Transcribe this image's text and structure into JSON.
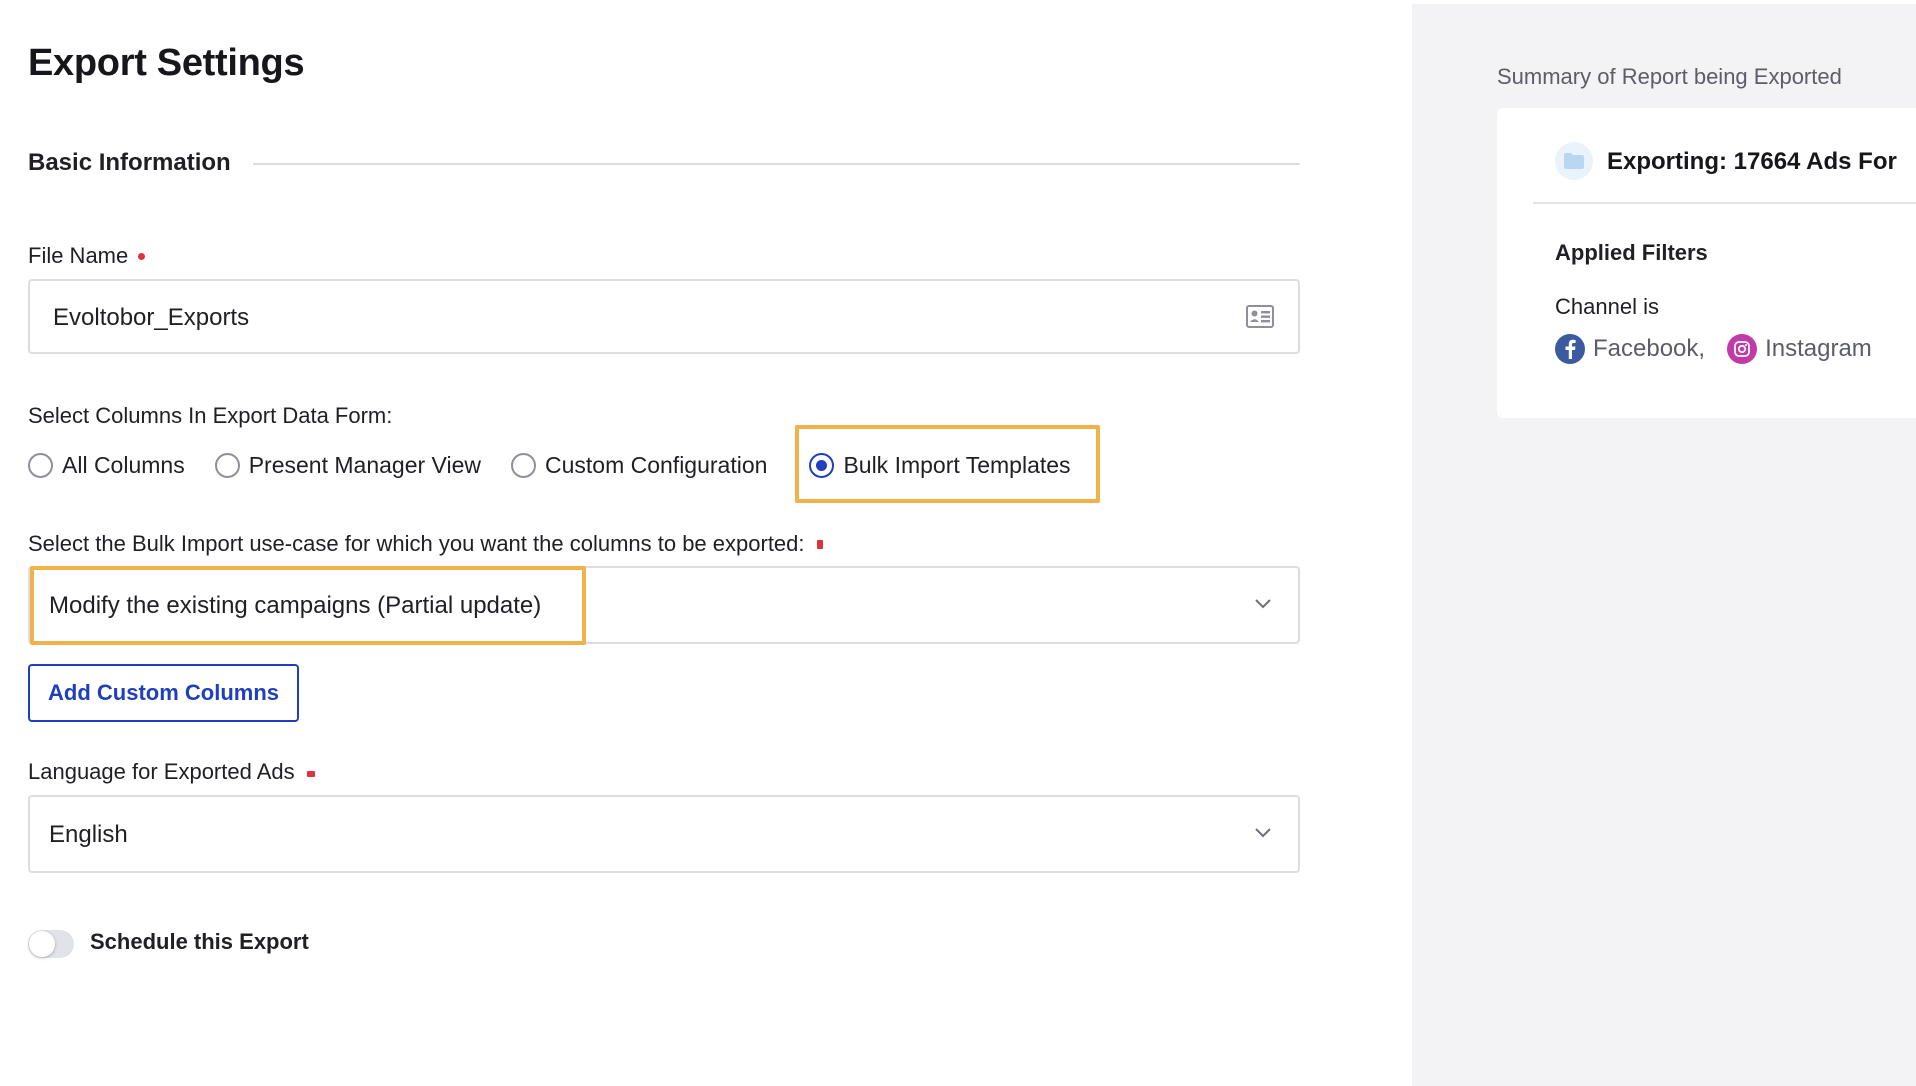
{
  "page": {
    "title": "Export Settings"
  },
  "basic_info": {
    "section_label": "Basic Information"
  },
  "file_name": {
    "label": "File Name",
    "value": "Evoltobor_Exports",
    "icon": "contact-card-icon"
  },
  "columns": {
    "label": "Select Columns In Export Data Form:",
    "options": [
      {
        "label": "All Columns",
        "checked": false
      },
      {
        "label": "Present Manager View",
        "checked": false
      },
      {
        "label": "Custom Configuration",
        "checked": false
      },
      {
        "label": "Bulk Import Templates",
        "checked": true
      }
    ]
  },
  "bulk_usecase": {
    "label": "Select the Bulk Import use-case for which you want the columns to be exported:",
    "value": "Modify the existing campaigns (Partial update)"
  },
  "add_columns_button": {
    "label": "Add Custom Columns"
  },
  "language": {
    "label": "Language for Exported Ads",
    "value": "English"
  },
  "schedule": {
    "label": "Schedule this Export",
    "enabled": false
  },
  "summary": {
    "title": "Summary of Report being Exported",
    "card_title": "Exporting: 17664 Ads For",
    "filters_label": "Applied Filters",
    "channel_label": "Channel is",
    "channels": [
      {
        "label": "Facebook,",
        "icon": "facebook-icon"
      },
      {
        "label": "Instagram",
        "icon": "instagram-icon"
      }
    ]
  },
  "colors": {
    "accent": "#1f3fbf",
    "highlight": "#f0b34a",
    "required": "#e0323e",
    "side_panel": "#f3f3f5"
  }
}
